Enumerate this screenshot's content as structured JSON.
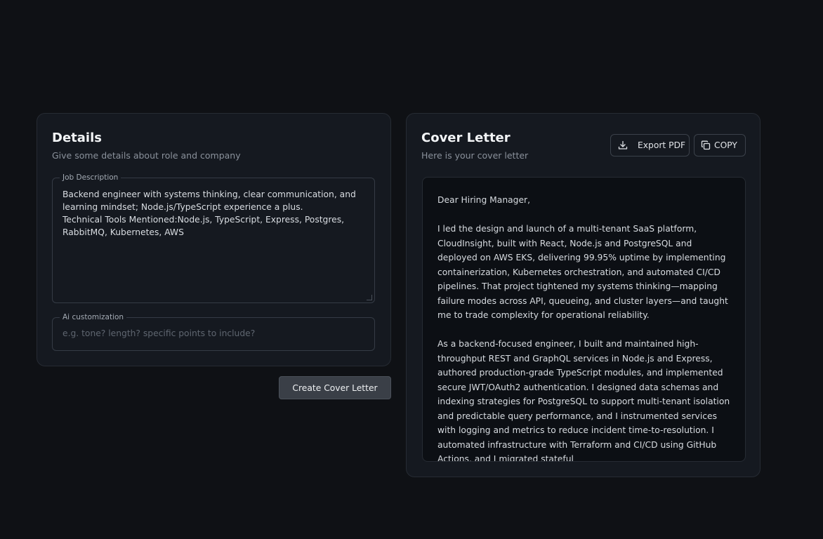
{
  "details": {
    "title": "Details",
    "subtitle": "Give some details about role and company",
    "job_description": {
      "label": "Job Description",
      "value": "Backend engineer with systems thinking, clear communication, and learning mindset; Node.js/TypeScript experience a plus.\nTechnical Tools Mentioned:Node.js, TypeScript, Express, Postgres, RabbitMQ, Kubernetes, AWS"
    },
    "ai_customization": {
      "label": "Ai customization",
      "placeholder": "e.g. tone? length? specific points to include?",
      "value": ""
    }
  },
  "create_button": {
    "label": "Create Cover Letter"
  },
  "cover_letter": {
    "title": "Cover Letter",
    "subtitle": "Here is your cover letter",
    "export_button": {
      "label": "Export PDF",
      "icon": "download-icon"
    },
    "copy_button": {
      "label": "COPY",
      "icon": "copy-icon"
    },
    "paragraphs": [
      "Dear Hiring Manager,",
      "I led the design and launch of a multi-tenant SaaS platform, CloudInsight, built with React, Node.js and PostgreSQL and deployed on AWS EKS, delivering 99.95% uptime by implementing containerization, Kubernetes orchestration, and automated CI/CD pipelines. That project tightened my systems thinking—mapping failure modes across API, queueing, and cluster layers—and taught me to trade complexity for operational reliability.",
      "As a backend-focused engineer, I built and maintained high-throughput REST and GraphQL services in Node.js and Express, authored production-grade TypeScript modules, and implemented secure JWT/OAuth2 authentication. I designed data schemas and indexing strategies for PostgreSQL to support multi-tenant isolation and predictable query performance, and I instrumented services with logging and metrics to reduce incident time-to-resolution. I automated infrastructure with Terraform and CI/CD using GitHub Actions, and I migrated stateful"
    ]
  }
}
